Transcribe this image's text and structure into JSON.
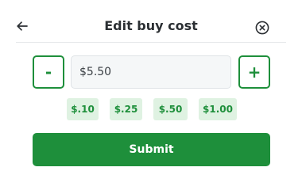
{
  "header": {
    "title": "Edit buy cost",
    "back_icon": "arrow-left-icon",
    "close_icon": "close-circle-icon"
  },
  "stepper": {
    "decrement_label": "-",
    "increment_label": "+",
    "value": "$5.50"
  },
  "quick_amounts": [
    {
      "label": "$.10"
    },
    {
      "label": "$.25"
    },
    {
      "label": "$.50"
    },
    {
      "label": "$1.00"
    }
  ],
  "submit_label": "Submit",
  "colors": {
    "accent": "#1e8f3b",
    "chip_bg": "#dff2e2",
    "title": "#2b2f33",
    "input_bg": "#f5f7f8"
  }
}
